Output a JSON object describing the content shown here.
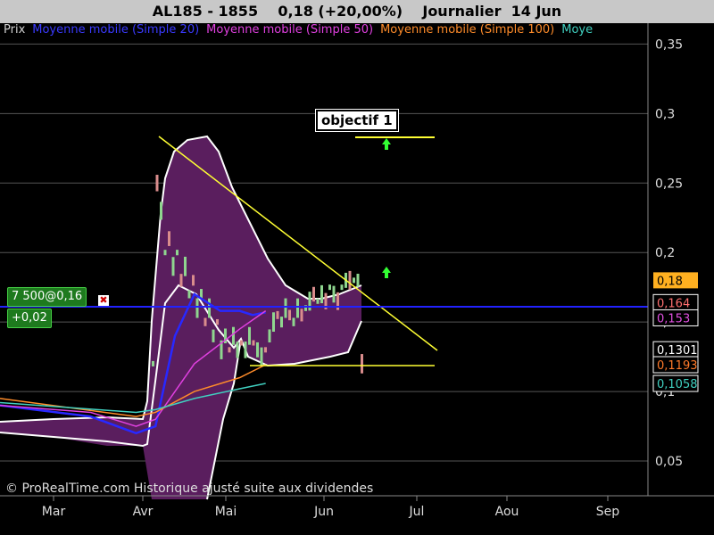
{
  "title": {
    "symbol": "AL185 - 1855",
    "quote": "0,18 (+20,00%)",
    "period": "Journalier",
    "date": "14 Jun"
  },
  "legend": [
    {
      "label": "Prix",
      "color": "#d0d0d0"
    },
    {
      "label": "Moyenne mobile (Simple 20)",
      "color": "#3a3aff"
    },
    {
      "label": "Moyenne mobile (Simple 50)",
      "color": "#e040e0"
    },
    {
      "label": "Moyenne mobile (Simple 100)",
      "color": "#ff8c2a"
    },
    {
      "label": "Moye",
      "color": "#40d0c0"
    }
  ],
  "order_badge": {
    "text": "7 500@0,16",
    "close": "✖"
  },
  "change_badge": {
    "text": "+0,02"
  },
  "objective_label": "objectif 1",
  "copyright": "© ProRealTime.com Historique ajusté suite aux dividendes",
  "colors": {
    "up_candle": "#8fd68f",
    "down_candle": "#d98c8c",
    "band_fill": "#5a1e5e",
    "sma20": "#2828ff",
    "sma50": "#e040e0",
    "sma100": "#ff8c2a",
    "sma200": "#40d0c0",
    "trendline": "#ffff33",
    "arrow": "#33ff33"
  },
  "chart_data": {
    "type": "candlestick",
    "x_tick_labels": [
      "Mar",
      "Avr",
      "Mai",
      "Jun",
      "Jul",
      "Aou",
      "Sep"
    ],
    "y_tick_labels": [
      "0,35",
      "0,3",
      "0,25",
      "0,2",
      "0,15",
      "0,1",
      "0,05"
    ],
    "y_ticks": [
      0.35,
      0.3,
      0.25,
      0.2,
      0.15,
      0.1,
      0.05
    ],
    "ylim": [
      0.025,
      0.365
    ],
    "price_labels": [
      {
        "text": "0,18",
        "value": 0.18,
        "bg": "#ffb020",
        "fg": "#000"
      },
      {
        "text": "0,164",
        "value": 0.164,
        "bg": "#000",
        "fg": "#ff7070"
      },
      {
        "text": "0,153",
        "value": 0.153,
        "bg": "#000",
        "fg": "#e050e0"
      },
      {
        "text": "0,1301",
        "value": 0.1301,
        "bg": "#000",
        "fg": "#ffffff"
      },
      {
        "text": "0,1193",
        "value": 0.1193,
        "bg": "#000",
        "fg": "#ff7a2a"
      },
      {
        "text": "0,1058",
        "value": 0.1058,
        "bg": "#000",
        "fg": "#40d0c0"
      }
    ],
    "horizontal_level": 0.164,
    "support_level": 0.1193,
    "objective_level": 0.28,
    "series": [
      {
        "name": "Moyenne mobile (Simple 20)",
        "x": [
          0.0,
          0.14,
          0.21,
          0.24,
          0.27,
          0.3,
          0.34,
          0.37,
          0.39,
          0.41
        ],
        "values": [
          0.09,
          0.082,
          0.07,
          0.075,
          0.14,
          0.17,
          0.158,
          0.158,
          0.155,
          0.157
        ]
      },
      {
        "name": "Moyenne mobile (Simple 50)",
        "x": [
          0.0,
          0.14,
          0.21,
          0.24,
          0.3,
          0.37,
          0.41
        ],
        "values": [
          0.09,
          0.085,
          0.075,
          0.08,
          0.12,
          0.145,
          0.158
        ]
      },
      {
        "name": "Moyenne mobile (Simple 100)",
        "x": [
          0.0,
          0.21,
          0.24,
          0.3,
          0.37,
          0.41
        ],
        "values": [
          0.095,
          0.082,
          0.085,
          0.1,
          0.11,
          0.1193
        ]
      },
      {
        "name": "Moye",
        "x": [
          0.0,
          0.21,
          0.24,
          0.3,
          0.37,
          0.41
        ],
        "values": [
          0.092,
          0.085,
          0.087,
          0.095,
          0.102,
          0.1058
        ]
      }
    ]
  }
}
